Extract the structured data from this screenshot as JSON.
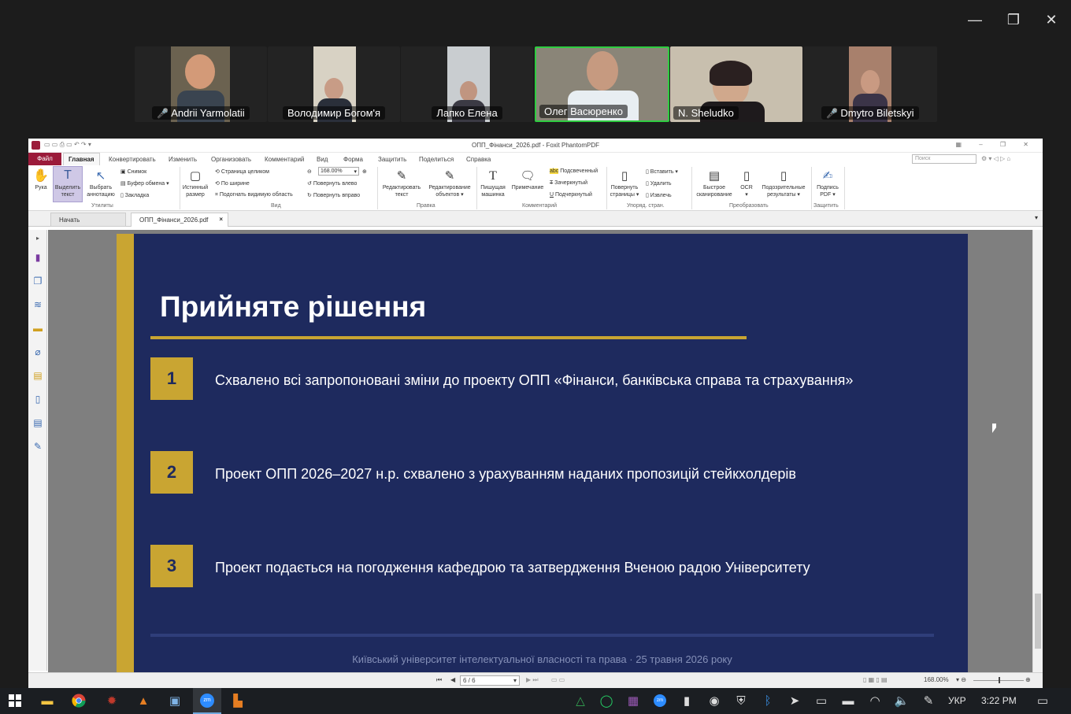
{
  "window_controls": {
    "minimize": "—",
    "restore": "❐",
    "close": "✕"
  },
  "participants": [
    {
      "name": "Andrii Yarmolatii",
      "muted": true
    },
    {
      "name": "Володимир Богом'я",
      "muted": false
    },
    {
      "name": "Лапко Елена",
      "muted": false
    },
    {
      "name": "Олег Васюренко",
      "muted": false,
      "active_speaker": true
    },
    {
      "name": "N. Sheludko",
      "muted": false
    },
    {
      "name": "Dmytro Biletskyi",
      "muted": true
    }
  ],
  "app": {
    "title": "ОПП_Фінанси_2026.pdf - Foxit PhantomPDF",
    "menu": [
      "Файл",
      "Главная",
      "Конвертировать",
      "Изменить",
      "Организовать",
      "Комментарий",
      "Вид",
      "Форма",
      "Защитить",
      "Поделиться",
      "Справка"
    ],
    "search_placeholder": "Поиск",
    "ribbon": {
      "hand": "Рука",
      "select_text": "Выделить текст",
      "select_annot": "Выбрать аннотацию",
      "snapshot": "Снимок",
      "clipboard": "Буфер обмена",
      "bookmark": "Закладка",
      "grp_utils": "Утилиты",
      "actual_size": "Истинный размер",
      "fit_page": "Страница целиком",
      "fit_width": "По ширине",
      "fit_visible": "Подогнать видимую область",
      "zoom": "168.00%",
      "rotate_left": "Повернуть влево",
      "rotate_right": "Повернуть вправо",
      "grp_view": "Вид",
      "edit_text": "Редактировать текст",
      "edit_obj": "Редактирование объектов",
      "grp_edit": "Правка",
      "typewriter": "Пишущая машинка",
      "note": "Примечание",
      "highlight": "Подсвеченный",
      "strikeout": "Зачеркнутый",
      "underline": "Подчеркнутый",
      "grp_comment": "Комментарий",
      "rotate_pages": "Повернуть страницы",
      "insert": "Вставить",
      "delete": "Удалить",
      "extract": "Извлечь",
      "grp_pages": "Упоряд. стран.",
      "quick_scan": "Быстрое сканирование",
      "ocr": "OCR",
      "suspect": "Подозрительные результаты",
      "grp_convert": "Преобразовать",
      "sign": "Подпись PDF",
      "grp_protect": "Защитить"
    },
    "tabs": [
      "Начать",
      "ОПП_Фінанси_2026.pdf"
    ],
    "page_nav": "6 / 6",
    "status_zoom": "168.00%"
  },
  "slide": {
    "title": "Прийняте рішення",
    "items": [
      {
        "num": "1",
        "text": "Схвалено всі запропоновані зміни до проекту ОПП «Фінанси, банківська справа та страхування»"
      },
      {
        "num": "2",
        "text": "Проект ОПП 2026–2027 н.р. схвалено з урахуванням наданих пропозицій стейкхолдерів"
      },
      {
        "num": "3",
        "text": "Проект подається на погодження кафедрою та затвердження Вченою радою Університету"
      }
    ],
    "footer": "Київський університет інтелектуальної власності та права · 25 травня 2026 року"
  },
  "taskbar": {
    "lang": "УКР",
    "time": "3:22 PM"
  },
  "colors": {
    "slide_bg": "#1e2a5e",
    "gold": "#c9a532",
    "active_speaker": "#2ecc40"
  }
}
